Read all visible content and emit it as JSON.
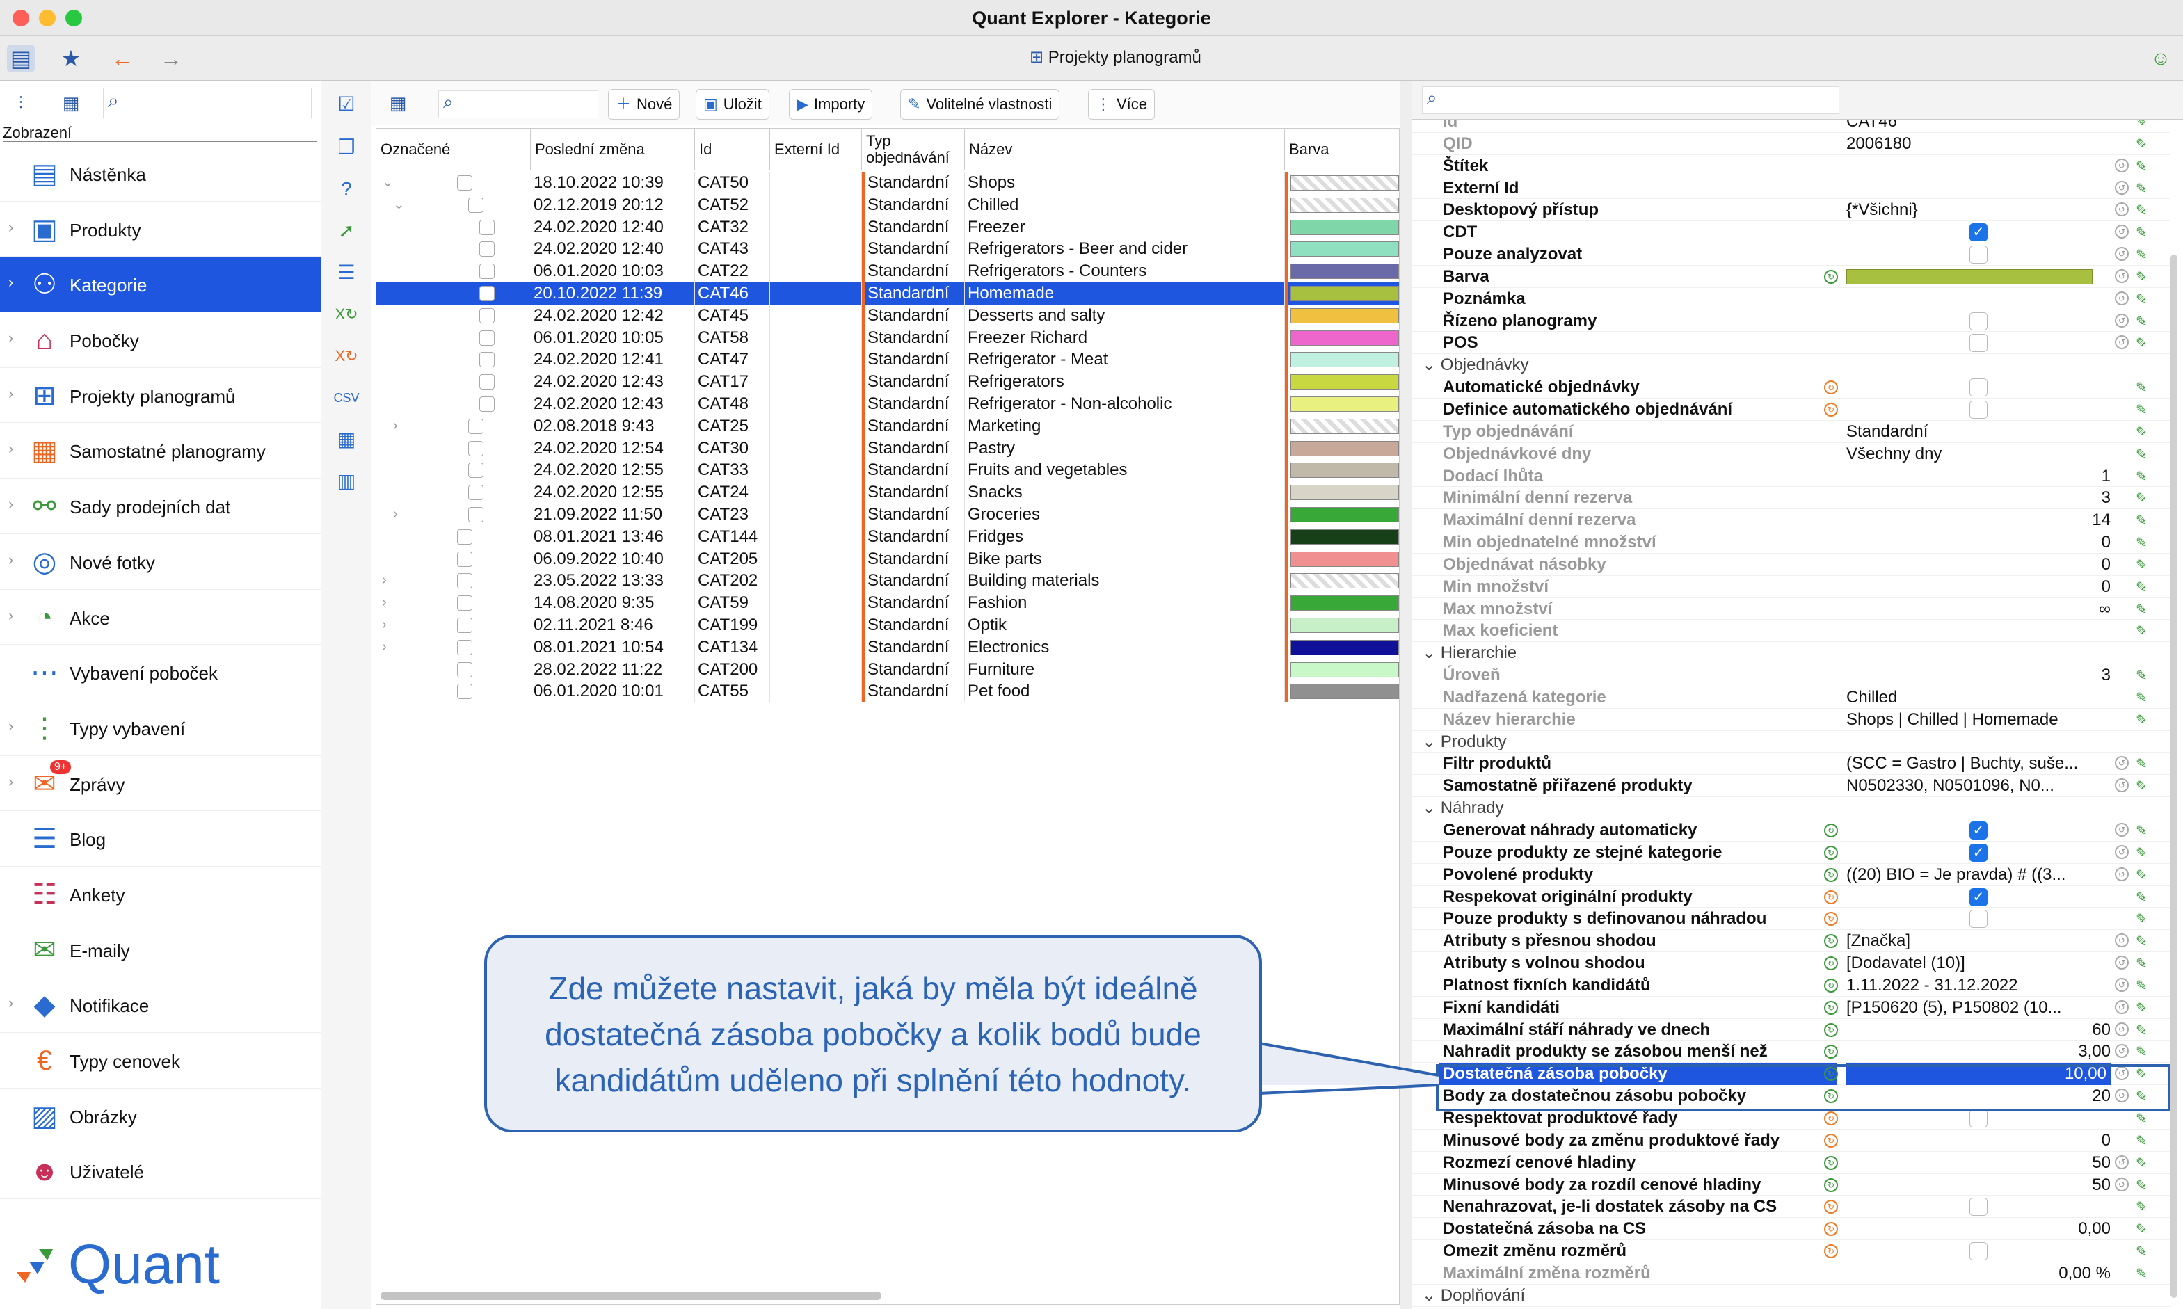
{
  "window": {
    "title": "Quant Explorer - Kategorie",
    "project_label": "Projekty planogramů"
  },
  "sidebar": {
    "view_label": "Zobrazení",
    "logo_text": "Quant",
    "items": [
      {
        "label": "Nástěnka",
        "icon": "dashboard-icon"
      },
      {
        "label": "Produkty",
        "icon": "product-icon"
      },
      {
        "label": "Kategorie",
        "icon": "categories-icon",
        "selected": true
      },
      {
        "label": "Pobočky",
        "icon": "store-icon"
      },
      {
        "label": "Projekty planogramů",
        "icon": "planogram-project-icon"
      },
      {
        "label": "Samostatné planogramy",
        "icon": "planogram-icon"
      },
      {
        "label": "Sady prodejních dat",
        "icon": "sales-data-icon"
      },
      {
        "label": "Nové fotky",
        "icon": "camera-icon"
      },
      {
        "label": "Akce",
        "icon": "promotion-icon"
      },
      {
        "label": "Vybavení poboček",
        "icon": "equipment-icon"
      },
      {
        "label": "Typy vybavení",
        "icon": "equipment-types-icon"
      },
      {
        "label": "Zprávy",
        "icon": "messages-icon",
        "badge": "9+"
      },
      {
        "label": "Blog",
        "icon": "blog-icon"
      },
      {
        "label": "Ankety",
        "icon": "survey-icon"
      },
      {
        "label": "E-maily",
        "icon": "email-icon"
      },
      {
        "label": "Notifikace",
        "icon": "bell-icon"
      },
      {
        "label": "Typy cenovek",
        "icon": "price-tag-icon"
      },
      {
        "label": "Obrázky",
        "icon": "image-icon"
      },
      {
        "label": "Uživatelé",
        "icon": "user-icon"
      }
    ]
  },
  "grid_toolbar": {
    "new": "Nové",
    "save": "Uložit",
    "imports": "Importy",
    "custom_props": "Volitelné vlastnosti",
    "more": "Více"
  },
  "grid": {
    "headers": [
      "Označené",
      "Poslední změna",
      "Id",
      "Externí Id",
      "Typ objednávání",
      "Název",
      "Barva"
    ],
    "rows": [
      {
        "date": "18.10.2022 10:39",
        "id": "CAT50",
        "order": "Standardní",
        "name": "Shops",
        "color": "checker",
        "tree": "open",
        "lvl": 0
      },
      {
        "date": "02.12.2019 20:12",
        "id": "CAT52",
        "order": "Standardní",
        "name": "Chilled",
        "color": "checker",
        "tree": "open",
        "lvl": 1
      },
      {
        "date": "24.02.2020 12:40",
        "id": "CAT32",
        "order": "Standardní",
        "name": "Freezer",
        "color": "#7fd6a8",
        "lvl": 2
      },
      {
        "date": "24.02.2020 12:40",
        "id": "CAT43",
        "order": "Standardní",
        "name": "Refrigerators - Beer and cider",
        "color": "#8fe0c0",
        "lvl": 2
      },
      {
        "date": "06.01.2020 10:03",
        "id": "CAT22",
        "order": "Standardní",
        "name": "Refrigerators - Counters",
        "color": "#6a6aa8",
        "lvl": 2
      },
      {
        "date": "20.10.2022 11:39",
        "id": "CAT46",
        "order": "Standardní",
        "name": "Homemade",
        "color": "#a8c040",
        "lvl": 2,
        "selected": true
      },
      {
        "date": "24.02.2020 12:42",
        "id": "CAT45",
        "order": "Standardní",
        "name": "Desserts and salty",
        "color": "#f0c040",
        "lvl": 2
      },
      {
        "date": "06.01.2020 10:05",
        "id": "CAT58",
        "order": "Standardní",
        "name": "Freezer Richard",
        "color": "#ee66cc",
        "lvl": 2
      },
      {
        "date": "24.02.2020 12:41",
        "id": "CAT47",
        "order": "Standardní",
        "name": "Refrigerator - Meat",
        "color": "#c0f0e0",
        "lvl": 2
      },
      {
        "date": "24.02.2020 12:43",
        "id": "CAT17",
        "order": "Standardní",
        "name": "Refrigerators",
        "color": "#c8d840",
        "lvl": 2
      },
      {
        "date": "24.02.2020 12:43",
        "id": "CAT48",
        "order": "Standardní",
        "name": "Refrigerator - Non-alcoholic",
        "color": "#e8f080",
        "lvl": 2
      },
      {
        "date": "02.08.2018 9:43",
        "id": "CAT25",
        "order": "Standardní",
        "name": "Marketing",
        "color": "checker",
        "tree": "closed",
        "lvl": 1
      },
      {
        "date": "24.02.2020 12:54",
        "id": "CAT30",
        "order": "Standardní",
        "name": "Pastry",
        "color": "#c8a898",
        "lvl": 1
      },
      {
        "date": "24.02.2020 12:55",
        "id": "CAT33",
        "order": "Standardní",
        "name": "Fruits and vegetables",
        "color": "#c0b8a8",
        "lvl": 1
      },
      {
        "date": "24.02.2020 12:55",
        "id": "CAT24",
        "order": "Standardní",
        "name": "Snacks",
        "color": "#d8d4c8",
        "lvl": 1
      },
      {
        "date": "21.09.2022 11:50",
        "id": "CAT23",
        "order": "Standardní",
        "name": "Groceries",
        "color": "#38a838",
        "tree": "closed",
        "lvl": 1
      },
      {
        "date": "08.01.2021 13:46",
        "id": "CAT144",
        "order": "Standardní",
        "name": "Fridges",
        "color": "#184018",
        "lvl": 0
      },
      {
        "date": "06.09.2022 10:40",
        "id": "CAT205",
        "order": "Standardní",
        "name": "Bike parts",
        "color": "#f09090",
        "lvl": 0
      },
      {
        "date": "23.05.2022 13:33",
        "id": "CAT202",
        "order": "Standardní",
        "name": "Building materials",
        "color": "checker",
        "tree": "closed",
        "lvl": 0
      },
      {
        "date": "14.08.2020 9:35",
        "id": "CAT59",
        "order": "Standardní",
        "name": "Fashion",
        "color": "#38a838",
        "tree": "closed",
        "lvl": 0
      },
      {
        "date": "02.11.2021 8:46",
        "id": "CAT199",
        "order": "Standardní",
        "name": "Optik",
        "color": "#c8f0c8",
        "tree": "closed",
        "lvl": 0
      },
      {
        "date": "08.01.2021 10:54",
        "id": "CAT134",
        "order": "Standardní",
        "name": "Electronics",
        "color": "#101098",
        "tree": "closed",
        "lvl": 0
      },
      {
        "date": "28.02.2022 11:22",
        "id": "CAT200",
        "order": "Standardní",
        "name": "Furniture",
        "color": "#c8f8c8",
        "lvl": 0
      },
      {
        "date": "06.01.2020 10:01",
        "id": "CAT55",
        "order": "Standardní",
        "name": "Pet food",
        "color": "#909090",
        "lvl": 0
      }
    ]
  },
  "props": {
    "rows": [
      {
        "label": "Id",
        "value": "CAT46",
        "grey": true
      },
      {
        "label": "QID",
        "value": "2006180",
        "grey": true
      },
      {
        "label": "Štítek",
        "value": "",
        "reset": true
      },
      {
        "label": "Externí Id",
        "value": "",
        "reset": true
      },
      {
        "label": "Desktopový přístup",
        "value": "{*Všichni}",
        "reset": true
      },
      {
        "label": "CDT",
        "check": "on",
        "reset": true
      },
      {
        "label": "Pouze analyzovat",
        "check": "off",
        "reset": true
      },
      {
        "label": "Barva",
        "barva": true,
        "icon": "g",
        "reset": true
      },
      {
        "label": "Poznámka",
        "value": "",
        "reset": true
      },
      {
        "label": "Řízeno planogramy",
        "check": "off",
        "reset": true
      },
      {
        "label": "POS",
        "check": "off",
        "reset": true
      },
      {
        "section": "Objednávky"
      },
      {
        "label": "Automatické objednávky",
        "check": "off",
        "icon": "o"
      },
      {
        "label": "Definice automatického objednávání",
        "check": "off",
        "icon": "o"
      },
      {
        "label": "Typ objednávání",
        "value": "Standardní",
        "grey": true
      },
      {
        "label": "Objednávkové dny",
        "value": "Všechny dny",
        "grey": true
      },
      {
        "label": "Dodací lhůta",
        "value": "1",
        "num": true,
        "grey": true
      },
      {
        "label": "Minimální denní rezerva",
        "value": "3",
        "num": true,
        "grey": true
      },
      {
        "label": "Maximální denní rezerva",
        "value": "14",
        "num": true,
        "grey": true
      },
      {
        "label": "Min objednatelné množství",
        "value": "0",
        "num": true,
        "grey": true
      },
      {
        "label": "Objednávat násobky",
        "value": "0",
        "num": true,
        "grey": true
      },
      {
        "label": "Min množství",
        "value": "0",
        "num": true,
        "grey": true
      },
      {
        "label": "Max množství",
        "value": "∞",
        "num": true,
        "grey": true
      },
      {
        "label": "Max koeficient",
        "value": "",
        "grey": true
      },
      {
        "section": "Hierarchie"
      },
      {
        "label": "Úroveň",
        "value": "3",
        "num": true,
        "grey": true
      },
      {
        "label": "Nadřazená kategorie",
        "value": "Chilled",
        "grey": true
      },
      {
        "label": "Název hierarchie",
        "value": "Shops | Chilled | Homemade",
        "grey": true
      },
      {
        "section": "Produkty"
      },
      {
        "label": "Filtr produktů",
        "value": "(SCC = Gastro | Buchty, suše...",
        "reset": true
      },
      {
        "label": "Samostatně přiřazené produkty",
        "value": "N0502330, N0501096, N0...",
        "reset": true
      },
      {
        "section": "Náhrady"
      },
      {
        "label": "Generovat náhrady automaticky",
        "check": "on",
        "icon": "g",
        "reset": true
      },
      {
        "label": "Pouze produkty ze stejné kategorie",
        "check": "on",
        "icon": "g",
        "reset": true
      },
      {
        "label": "Povolené produkty",
        "value": "((20) BIO = Je pravda) # ((3...",
        "icon": "g",
        "reset": true
      },
      {
        "label": "Respekovat originální produkty",
        "check": "on",
        "icon": "o"
      },
      {
        "label": "Pouze produkty s definovanou náhradou",
        "check": "off",
        "icon": "o"
      },
      {
        "label": "Atributy s přesnou shodou",
        "value": "[Značka]",
        "icon": "g",
        "reset": true
      },
      {
        "label": "Atributy s volnou shodou",
        "value": "[Dodavatel (10)]",
        "icon": "g",
        "reset": true
      },
      {
        "label": "Platnost fixních kandidátů",
        "value": "1.11.2022 - 31.12.2022",
        "icon": "g",
        "reset": true
      },
      {
        "label": "Fixní kandidáti",
        "value": "[P150620 (5), P150802 (10...",
        "icon": "g",
        "reset": true
      },
      {
        "label": "Maximální stáří náhrady ve dnech",
        "value": "60",
        "num": true,
        "icon": "g",
        "reset": true
      },
      {
        "label": "Nahradit produkty se zásobou menší než",
        "value": "3,00",
        "num": true,
        "icon": "g",
        "reset": true
      },
      {
        "label": "Dostatečná zásoba pobočky",
        "value": "10,00",
        "num": true,
        "icon": "g",
        "reset": true,
        "selected": true
      },
      {
        "label": "Body za dostatečnou zásobu pobočky",
        "value": "20",
        "num": true,
        "icon": "g",
        "reset": true
      },
      {
        "label": "Respektovat produktové řady",
        "check": "off",
        "icon": "o"
      },
      {
        "label": "Minusové body za změnu produktové řady",
        "value": "0",
        "num": true,
        "icon": "o"
      },
      {
        "label": "Rozmezí cenové hladiny",
        "value": "50",
        "num": true,
        "icon": "g",
        "reset": true
      },
      {
        "label": "Minusové body za rozdíl cenové hladiny",
        "value": "50",
        "num": true,
        "icon": "g",
        "reset": true
      },
      {
        "label": "Nenahrazovat, je-li dostatek zásoby na CS",
        "check": "off",
        "icon": "o"
      },
      {
        "label": "Dostatečná zásoba na CS",
        "value": "0,00",
        "num": true,
        "icon": "o"
      },
      {
        "label": "Omezit změnu rozměrů",
        "check": "off",
        "icon": "o"
      },
      {
        "label": "Maximální změna rozměrů",
        "value": "0,00 %",
        "num": true,
        "grey": true
      },
      {
        "section": "Doplňování"
      }
    ]
  },
  "callout": {
    "text": "Zde můžete nastavit, jaká by měla být ideálně dostatečná zásoba pobočky a kolik bodů bude kandidátům uděleno při splnění této hodnoty."
  },
  "colors": {
    "accent": "#1f56e0",
    "callout_border": "#2d62b0",
    "callout_bg": "#e9eef6",
    "callout_text": "#2b63b5"
  }
}
